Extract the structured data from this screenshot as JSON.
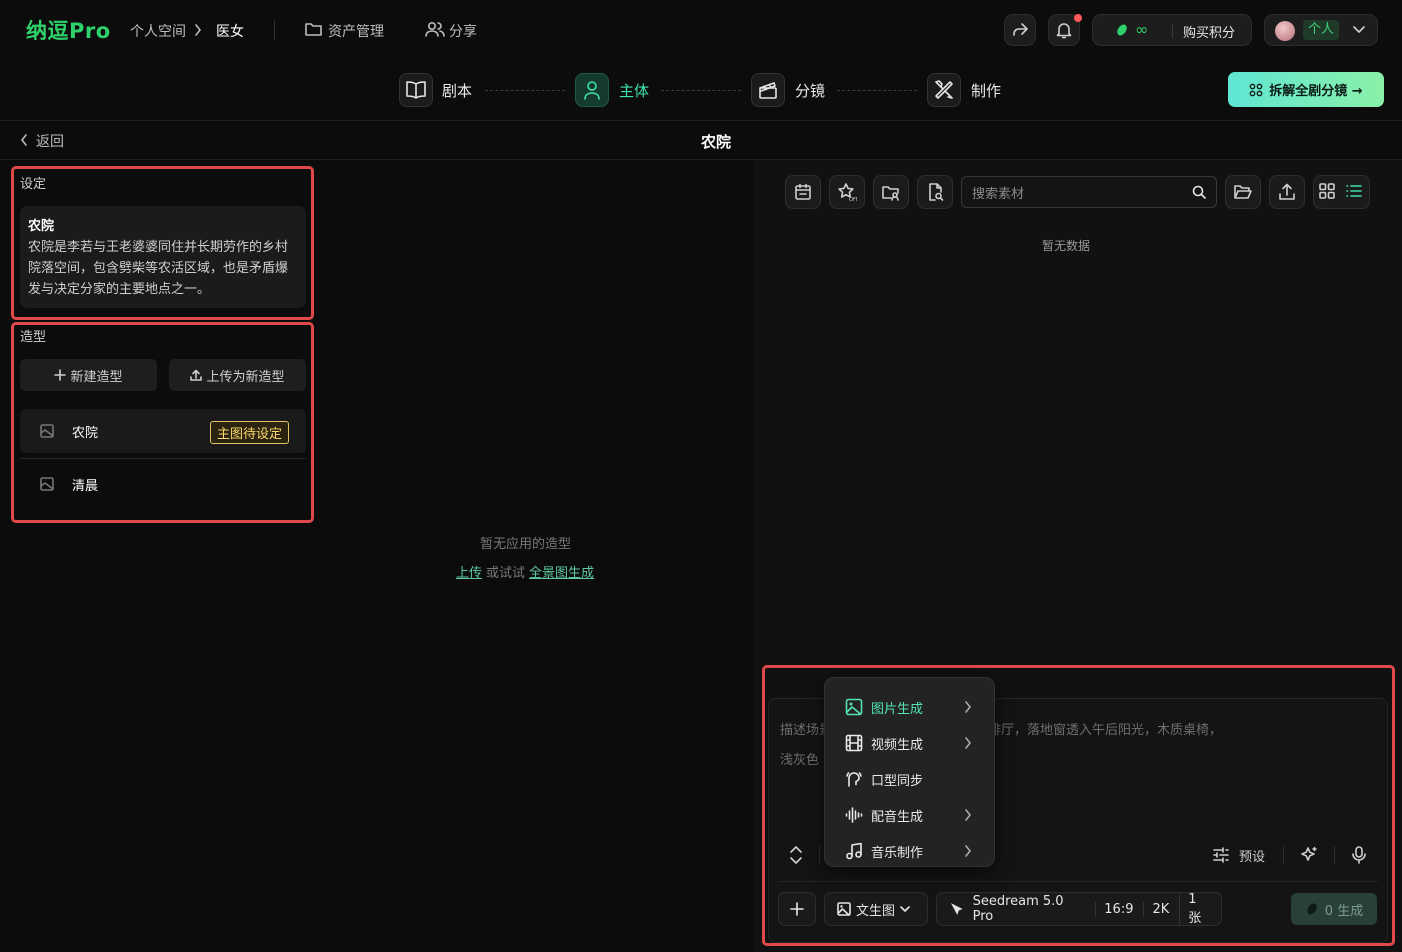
{
  "brand": {
    "logo": "纳逗Pro"
  },
  "header": {
    "breadcrumb": {
      "space": "个人空间",
      "sep": "›",
      "project": "医女"
    },
    "nav": {
      "assets": "资产管理",
      "share": "分享"
    },
    "credits": {
      "amount": "∞",
      "buy": "购买积分"
    },
    "user": {
      "label": "个人"
    }
  },
  "steps": [
    {
      "label": "剧本",
      "icon": "book-icon"
    },
    {
      "label": "主体",
      "icon": "person-icon"
    },
    {
      "label": "分镜",
      "icon": "clapper-icon"
    },
    {
      "label": "制作",
      "icon": "tools-icon"
    }
  ],
  "decompose_button": "拆解全剧分镜 →",
  "subheader": {
    "back": "返回",
    "title": "农院"
  },
  "setting": {
    "section_title": "设定",
    "card_title": "农院",
    "card_body": "农院是李若与王老婆婆同住并长期劳作的乡村院落空间，包含劈柴等农活区域，也是矛盾爆发与决定分家的主要地点之一。"
  },
  "looks": {
    "section_title": "造型",
    "new_button": "新建造型",
    "upload_button": "上传为新造型",
    "items": [
      {
        "name": "农院",
        "badge": "主图待设定"
      },
      {
        "name": "清晨",
        "badge": ""
      }
    ]
  },
  "center": {
    "empty": "暂无应用的造型",
    "upload_link": "上传",
    "or_try": "或试试",
    "panorama_link": "全景图生成"
  },
  "library": {
    "search_placeholder": "搜索素材",
    "empty": "暂无数据"
  },
  "composer": {
    "placeholder_line1": "描述场景，例如：一间明亮的现代咖啡厅，落地窗透入午后阳光，木质桌椅，",
    "placeholder_line2": "浅灰色",
    "preset": "预设",
    "mode": "文生图",
    "model": "Seedream 5.0 Pro",
    "ratio": "16:9",
    "resolution": "2K",
    "count": "1张",
    "generate": "0 生成"
  },
  "menu": {
    "items": [
      {
        "label": "图片生成",
        "icon": "image-icon",
        "submenu": true,
        "selected": true
      },
      {
        "label": "视频生成",
        "icon": "film-icon",
        "submenu": true,
        "selected": false
      },
      {
        "label": "口型同步",
        "icon": "lipsync-icon",
        "submenu": false,
        "selected": false
      },
      {
        "label": "配音生成",
        "icon": "waveform-icon",
        "submenu": true,
        "selected": false
      },
      {
        "label": "音乐制作",
        "icon": "music-icon",
        "submenu": true,
        "selected": false
      }
    ]
  },
  "colors": {
    "accent": "#3fe3a8",
    "brand": "#2fd26a",
    "highlight_border": "#e04949",
    "badge": "#ffd76a"
  }
}
